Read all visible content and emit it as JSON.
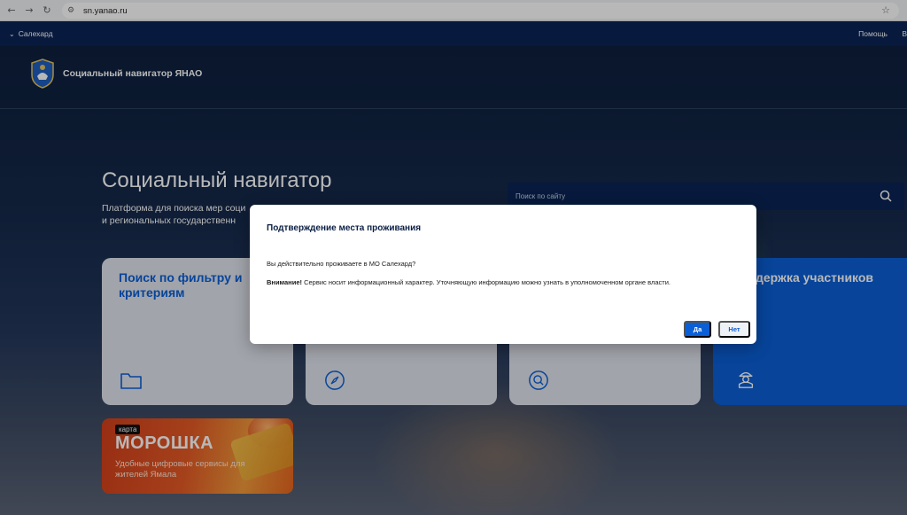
{
  "browser": {
    "url": "sn.yanao.ru",
    "back_icon": "back-arrow-icon",
    "forward_icon": "forward-arrow-icon",
    "reload_icon": "reload-icon",
    "bookmark_icon": "star-icon"
  },
  "topbar": {
    "city": "Салехард",
    "help": "Помощь",
    "cut_letter": "В"
  },
  "header": {
    "brand": "Социальный навигатор ЯНАО"
  },
  "hero": {
    "title": "Социальный навигатор",
    "subtitle": "Платформа для поиска мер соци и региональных государственн",
    "search_placeholder": "Поиск по сайту"
  },
  "cards": [
    {
      "title": "Поиск по фильтру и критериям",
      "icon": "folder-icon"
    },
    {
      "title": "",
      "icon": "compass-icon"
    },
    {
      "title": "",
      "icon": "search-icon"
    },
    {
      "title": "держка участников",
      "icon": "soldier-icon"
    }
  ],
  "promo": {
    "tag": "карта",
    "title": "МОРОШКА",
    "text": "Удобные цифровые сервисы для жителей Ямала"
  },
  "modal": {
    "title": "Подтверждение места проживания",
    "question": "Вы действительно проживаете в МО Салехард?",
    "note_bold": "Внимание!",
    "note_text": " Сервис носит информационный характер. Уточняющую информацию можно узнать в уполномоченном органе власти.",
    "yes": "Да",
    "no": "Нет"
  },
  "colors": {
    "accent": "#0b5fd6",
    "navy": "#0b2455"
  }
}
